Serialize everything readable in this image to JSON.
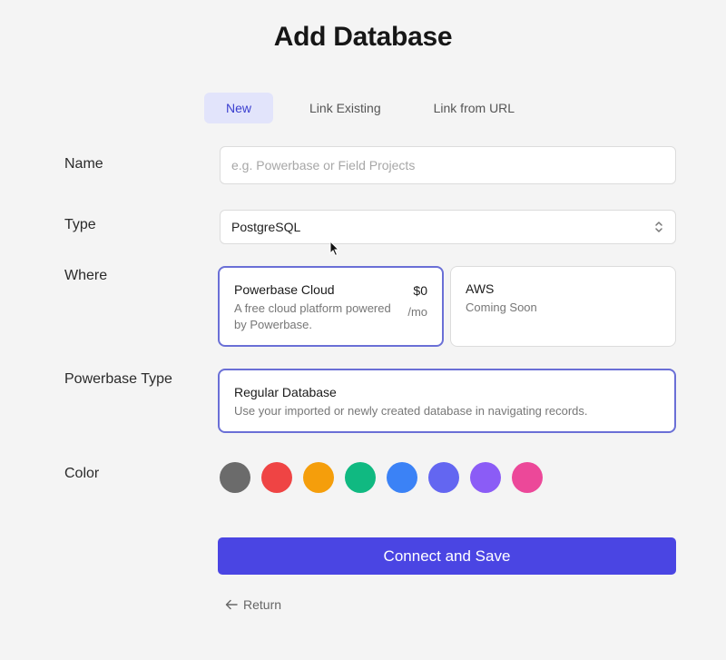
{
  "page": {
    "title": "Add Database"
  },
  "tabs": [
    {
      "label": "New",
      "active": true
    },
    {
      "label": "Link Existing",
      "active": false
    },
    {
      "label": "Link from URL",
      "active": false
    }
  ],
  "form": {
    "name": {
      "label": "Name",
      "value": "",
      "placeholder": "e.g. Powerbase or Field Projects"
    },
    "type": {
      "label": "Type",
      "value": "PostgreSQL"
    },
    "where": {
      "label": "Where",
      "options": [
        {
          "title": "Powerbase Cloud",
          "description": "A free cloud platform powered by Powerbase.",
          "price": "$0",
          "period": "/mo",
          "selected": true
        },
        {
          "title": "AWS",
          "description": "Coming Soon",
          "selected": false
        }
      ]
    },
    "powerbase_type": {
      "label": "Powerbase Type",
      "option": {
        "title": "Regular Database",
        "description": "Use your imported or newly created database in navigating records.",
        "selected": true
      }
    },
    "color": {
      "label": "Color",
      "swatches": [
        "#6b6b6b",
        "#ef4444",
        "#f59e0b",
        "#10b981",
        "#3b82f6",
        "#6366f1",
        "#8b5cf6",
        "#ec4899"
      ]
    }
  },
  "actions": {
    "submit_label": "Connect and Save",
    "return_label": "Return"
  },
  "colors": {
    "accent": "#4a45e3",
    "tab_active_bg": "#e2e4fb",
    "selected_border": "#6a6fd6"
  },
  "icons": {
    "select_chevron": "chevron-up-down-icon",
    "return_arrow": "arrow-left-icon",
    "cursor": "mouse-pointer-icon"
  }
}
